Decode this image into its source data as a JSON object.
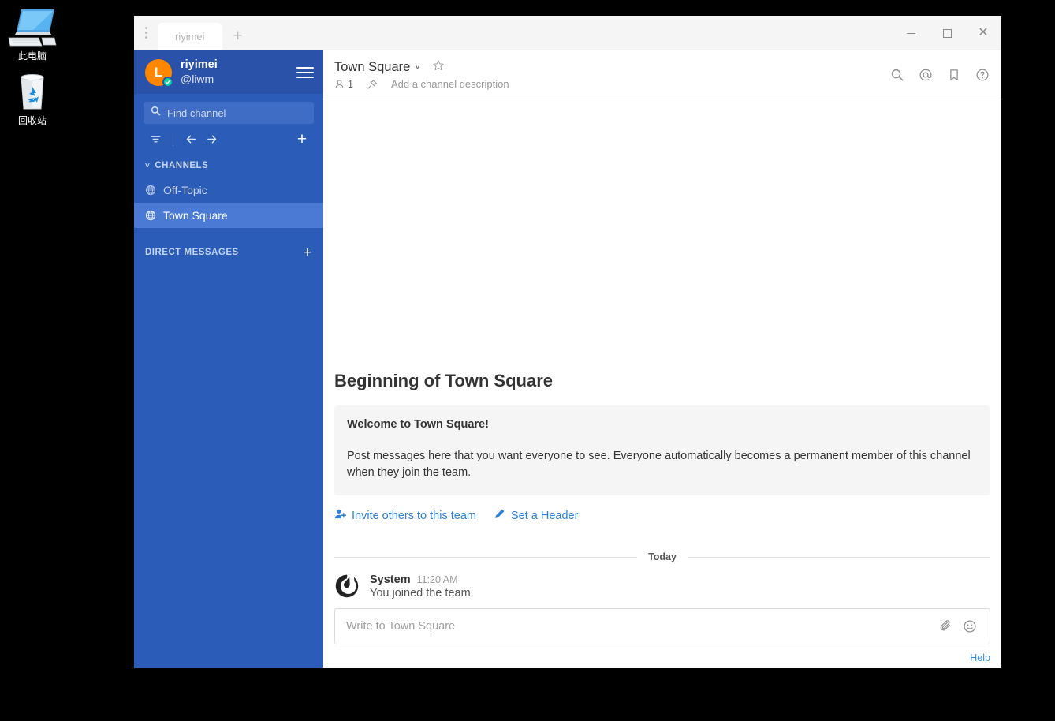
{
  "desktop": {
    "icons": [
      {
        "name": "this-pc",
        "label": "此电脑"
      },
      {
        "name": "recycle-bin",
        "label": "回收站"
      }
    ]
  },
  "window": {
    "tabbar": {
      "menu_icon": "dots-vertical-icon",
      "tabs": [
        {
          "label": "riyimei",
          "active": true
        }
      ],
      "add_tab_label": "+",
      "controls": {
        "minimize": "minimize-icon",
        "maximize": "maximize-icon",
        "close": "close-icon"
      }
    }
  },
  "sidebar": {
    "team_name": "riyimei",
    "user_handle": "@liwm",
    "avatar_initial": "L",
    "avatar_color": "#ff8800",
    "status": "online",
    "status_color": "#06d6a0",
    "menu_icon": "hamburger-icon",
    "search": {
      "placeholder": "Find channel",
      "icon": "search-icon"
    },
    "tools": {
      "filter_icon": "filter-icon",
      "back_icon": "arrow-left-icon",
      "forward_icon": "arrow-right-icon",
      "add_icon": "plus-icon",
      "add_label": "+"
    },
    "sections": [
      {
        "name": "channels",
        "label": "CHANNELS",
        "chevron": "˅",
        "items": [
          {
            "label": "Off-Topic",
            "icon": "globe-icon",
            "active": false
          },
          {
            "label": "Town Square",
            "icon": "globe-icon",
            "active": true
          }
        ]
      },
      {
        "name": "direct-messages",
        "label": "DIRECT MESSAGES",
        "add_label": "+",
        "items": []
      }
    ],
    "accent_color": "#2a5cb8",
    "active_color": "#4a7ad4"
  },
  "channel_header": {
    "title": "Town Square",
    "caret": "˅",
    "favorite_icon": "star-outline-icon",
    "member_count": "1",
    "members_icon": "person-icon",
    "pin_icon": "pin-icon",
    "description_placeholder": "Add a channel description",
    "actions": [
      {
        "name": "search",
        "icon": "search-icon"
      },
      {
        "name": "recent-mentions",
        "icon": "at-mention-icon"
      },
      {
        "name": "saved-posts",
        "icon": "bookmark-icon"
      },
      {
        "name": "help",
        "icon": "question-circle-icon"
      }
    ]
  },
  "main": {
    "intro_title": "Beginning of Town Square",
    "welcome_title": "Welcome to Town Square!",
    "welcome_body": "Post messages here that you want everyone to see. Everyone automatically becomes a permanent member of this channel when they join the team.",
    "actions": [
      {
        "name": "invite-others",
        "label": "Invite others to this team",
        "icon": "add-user-icon"
      },
      {
        "name": "set-header",
        "label": "Set a Header",
        "icon": "pencil-icon"
      }
    ],
    "date_separator": "Today",
    "posts": [
      {
        "author": "System",
        "time": "11:20 AM",
        "text": "You joined the team.",
        "avatar_icon": "mattermost-logo-icon"
      }
    ]
  },
  "composer": {
    "placeholder": "Write to Town Square",
    "attach_icon": "paperclip-icon",
    "emoji_icon": "emoji-smiley-icon",
    "help_label": "Help"
  }
}
